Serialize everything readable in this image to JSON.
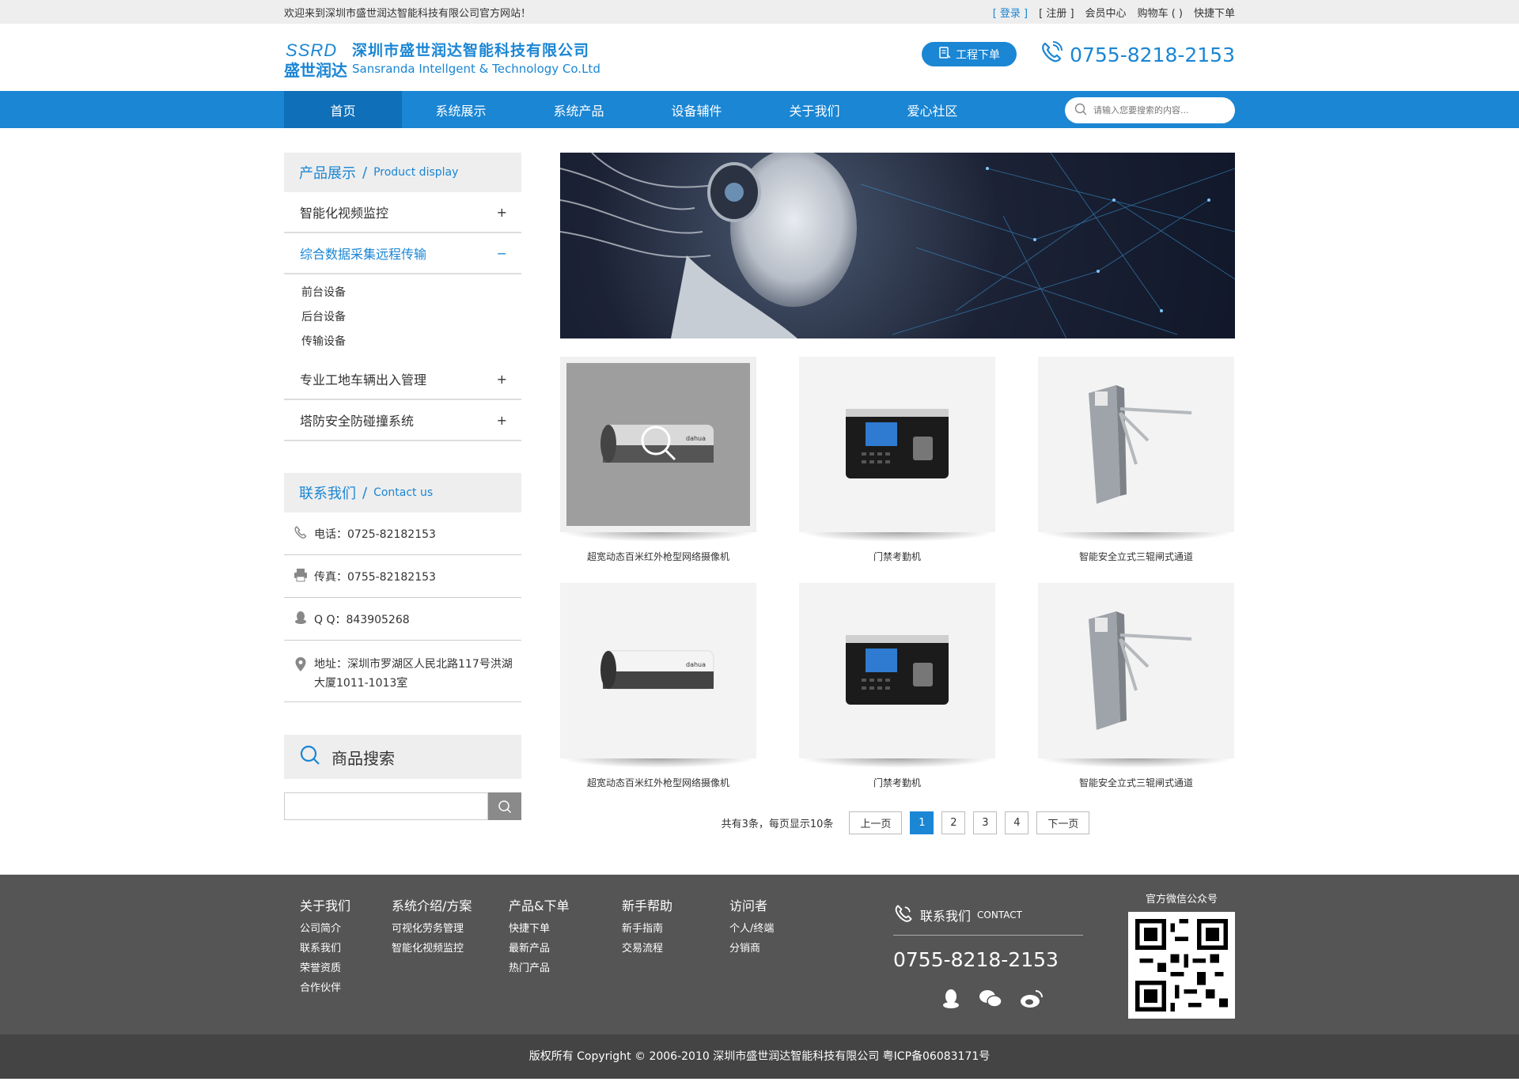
{
  "topbar": {
    "welcome": "欢迎来到深圳市盛世润达智能科技有限公司官方网站！",
    "login": "[ 登录 ]",
    "register": "[ 注册 ]",
    "member": "会员中心",
    "cart": "购物车 (  )",
    "quick_order": "快捷下单"
  },
  "header": {
    "logo_mark": "SSRD",
    "logo_cn_short": "盛世润达",
    "company_cn": "深圳市盛世润达智能科技有限公司",
    "company_en": "Sansranda Intellgent & Technology Co.Ltd",
    "order_button": "工程下单",
    "phone": "0755-8218-2153"
  },
  "nav": {
    "items": [
      "首页",
      "系统展示",
      "系统产品",
      "设备辅件",
      "关于我们",
      "爱心社区"
    ],
    "search_placeholder": "请输入您要搜索的内容..."
  },
  "sidebar": {
    "product_title": "产品展示",
    "product_title_en": "Product display",
    "categories": [
      {
        "label": "智能化视频监控",
        "toggle": "+"
      },
      {
        "label": "综合数据采集远程传输",
        "toggle": "−"
      },
      {
        "label": "专业工地车辆出入管理",
        "toggle": "+"
      },
      {
        "label": "塔防安全防碰撞系统",
        "toggle": "+"
      }
    ],
    "subcategories": [
      "前台设备",
      "后台设备",
      "传输设备"
    ],
    "contact_title": "联系我们",
    "contact_title_en": "Contact us",
    "tel": "电话：0725-82182153",
    "fax": "传真：0755-82182153",
    "qq": "Q Q：843905268",
    "address": "地址：深圳市罗湖区人民北路117号洪湖大厦1011-1013室",
    "goods_search_title": "商品搜索"
  },
  "products": [
    {
      "name": "超宽动态百米红外枪型网络摄像机",
      "icon": "bullet-camera"
    },
    {
      "name": "门禁考勤机",
      "icon": "attendance-machine"
    },
    {
      "name": "智能安全立式三辊闸式通道",
      "icon": "tripod-turnstile"
    },
    {
      "name": "超宽动态百米红外枪型网络摄像机",
      "icon": "bullet-camera"
    },
    {
      "name": "门禁考勤机",
      "icon": "attendance-machine"
    },
    {
      "name": "智能安全立式三辊闸式通道",
      "icon": "tripod-turnstile"
    }
  ],
  "pager": {
    "info": "共有3条，每页显示10条",
    "prev": "上一页",
    "pages": [
      "1",
      "2",
      "3",
      "4"
    ],
    "current": "1",
    "next": "下一页"
  },
  "footer": {
    "columns": [
      {
        "title": "关于我们",
        "items": [
          "公司简介",
          "联系我们",
          "荣誉资质",
          "合作伙伴"
        ]
      },
      {
        "title": "系统介绍/方案",
        "items": [
          "可视化劳务管理",
          "智能化视频监控"
        ]
      },
      {
        "title": "产品&下单",
        "items": [
          "快捷下单",
          "最新产品",
          "热门产品"
        ]
      },
      {
        "title": "新手帮助",
        "items": [
          "新手指南",
          "交易流程"
        ]
      },
      {
        "title": "访问者",
        "items": [
          "个人/终端",
          "分销商"
        ]
      }
    ],
    "contact_title": "联系我们",
    "contact_title_en": "CONTACT",
    "phone": "0755-8218-2153",
    "qr_title": "官方微信公众号",
    "copyright": "版权所有  Copyright © 2006-2010  深圳市盛世润达智能科技有限公司  粤ICP备06083171号"
  },
  "colors": {
    "accent": "#1a86d4",
    "footer_bg": "#555555",
    "copyright_bg": "#444444"
  }
}
